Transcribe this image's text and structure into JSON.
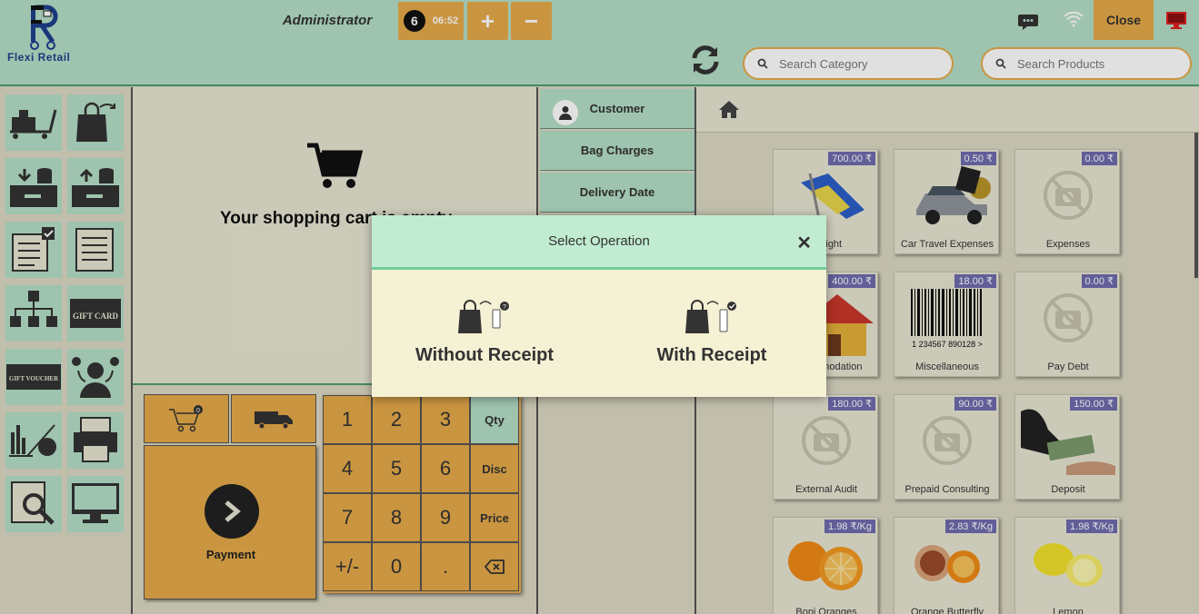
{
  "header": {
    "logo_text": "Flexi Retail",
    "user": "Administrator",
    "order_count": "6",
    "clock": "06:52",
    "plus": "+",
    "minus": "−",
    "close_label": "Close",
    "search_category_placeholder": "Search Category",
    "search_products_placeholder": "Search Products"
  },
  "left_buttons": [
    {
      "name": "trolley-icon"
    },
    {
      "name": "bag-export-icon"
    },
    {
      "name": "cash-in-icon"
    },
    {
      "name": "cash-out-icon"
    },
    {
      "name": "checklist-icon"
    },
    {
      "name": "list-icon"
    },
    {
      "name": "hierarchy-icon"
    },
    {
      "name": "gift-card-icon",
      "text": "GIFT CARD"
    },
    {
      "name": "gift-voucher-icon",
      "text": "GIFT VOUCHER"
    },
    {
      "name": "customers-icon"
    },
    {
      "name": "report-chart-icon"
    },
    {
      "name": "printer-icon"
    },
    {
      "name": "magnify-report-icon"
    },
    {
      "name": "monitor-icon"
    }
  ],
  "cart": {
    "empty_text": "Your shopping cart is empty"
  },
  "actions": {
    "customer": "Customer",
    "bag_charges": "Bag Charges",
    "delivery_date": "Delivery Date"
  },
  "bottom": {
    "cart_count": "0",
    "payment_label": "Payment"
  },
  "numpad": {
    "keys": [
      "1",
      "2",
      "3",
      "Qty",
      "4",
      "5",
      "6",
      "Disc",
      "7",
      "8",
      "9",
      "Price",
      "+/-",
      "0",
      "."
    ]
  },
  "products": [
    {
      "name": "Freight",
      "price": "700.00 ₹"
    },
    {
      "name": "Car Travel Expenses",
      "price": "0.50 ₹"
    },
    {
      "name": "Expenses",
      "price": "0.00 ₹"
    },
    {
      "name": "Accommodation",
      "price": "400.00 ₹"
    },
    {
      "name": "Miscellaneous",
      "price": "18.00 ₹"
    },
    {
      "name": "Pay Debt",
      "price": "0.00 ₹"
    },
    {
      "name": "External Audit",
      "price": "180.00 ₹"
    },
    {
      "name": "Prepaid Consulting",
      "price": "90.00 ₹"
    },
    {
      "name": "Deposit",
      "price": "150.00 ₹"
    },
    {
      "name": "Boni Oranges",
      "price": "1.98 ₹/Kg"
    },
    {
      "name": "Orange Butterfly",
      "price": "2.83 ₹/Kg"
    },
    {
      "name": "Lemon",
      "price": "1.98 ₹/Kg"
    }
  ],
  "barcode_text": "1 234567 890128 >",
  "modal": {
    "title": "Select Operation",
    "without_receipt": "Without Receipt",
    "with_receipt": "With Receipt"
  },
  "colors": {
    "header": "#b4dfc6",
    "accent": "#e6aa49",
    "modal_head": "#c1ecd1",
    "price_badge": "#6f6cae"
  }
}
